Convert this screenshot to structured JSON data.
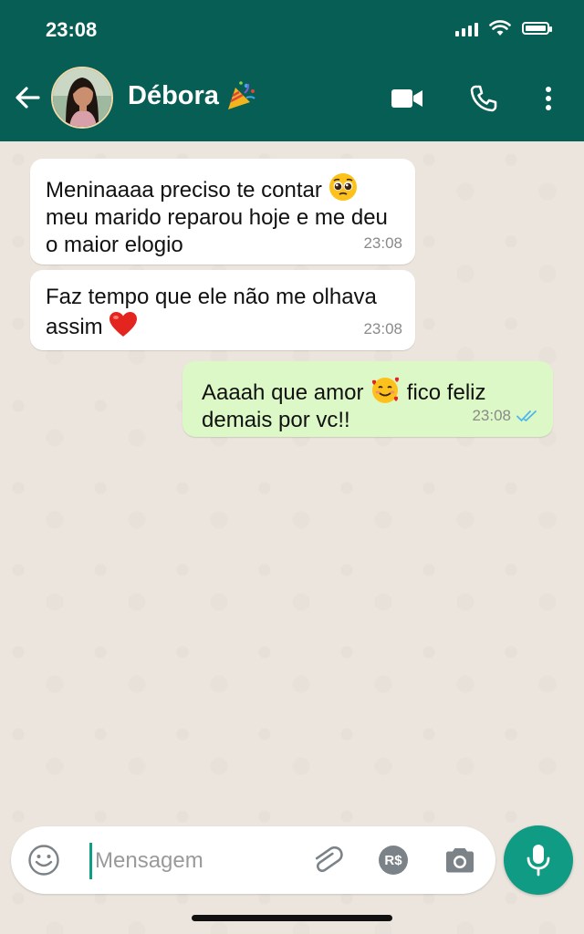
{
  "status_bar": {
    "time": "23:08"
  },
  "header": {
    "contact_name": "Débora",
    "name_emoji": "party-popper",
    "icons": [
      "back-arrow-icon",
      "video-call-icon",
      "phone-icon",
      "more-vert-icon"
    ]
  },
  "messages": [
    {
      "direction": "incoming",
      "text_before_emoji": "Meninaaaa preciso te contar ",
      "emoji": "pleading-face",
      "text_after_emoji": " meu marido reparou hoje e me deu o maior elogio",
      "time": "23:08"
    },
    {
      "direction": "incoming",
      "text_before_emoji": "Faz tempo que ele não me olhava assim ",
      "emoji": "red-heart",
      "text_after_emoji": "",
      "time": "23:08"
    },
    {
      "direction": "outgoing",
      "text_before_emoji": "Aaaah que amor ",
      "emoji": "smiling-face-with-hearts",
      "text_after_emoji": " fico feliz demais por vc!!",
      "time": "23:08",
      "status": "read-double-check"
    }
  ],
  "composer": {
    "placeholder": "Mensagem",
    "payment_label": "R$"
  },
  "colors": {
    "header": "#075e54",
    "outgoing_bubble": "#dcf8c6",
    "incoming_bubble": "#ffffff",
    "mic_button": "#109b84",
    "read_ticks": "#4fb6ec"
  }
}
